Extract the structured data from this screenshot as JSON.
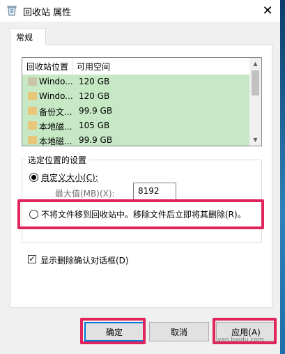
{
  "window": {
    "title": "回收站 属性",
    "close_label": "✕",
    "icon": "recycle-bin-icon"
  },
  "tabs": [
    {
      "label": "常规",
      "selected": true
    }
  ],
  "location_list": {
    "headers": {
      "location": "回收站位置",
      "space": "可用空间"
    },
    "rows": [
      {
        "name": "Windo...",
        "space": "120 GB",
        "icon": "drive-icon"
      },
      {
        "name": "Windo...",
        "space": "120 GB",
        "icon": "folder-icon"
      },
      {
        "name": "备份文...",
        "space": "99.9 GB",
        "icon": "folder-icon"
      },
      {
        "name": "本地磁...",
        "space": "105 GB",
        "icon": "folder-icon"
      },
      {
        "name": "本地磁...",
        "space": "99.9 GB",
        "icon": "folder-icon"
      }
    ]
  },
  "settings": {
    "group_title": "选定位置的设置",
    "custom_size_label": "自定义大小(C):",
    "max_label": "最大值(MB)(X):",
    "max_value": "8192",
    "no_move_label": "不将文件移到回收站中。移除文件后立即将其删除(R)。"
  },
  "confirm_delete_label": "显示删除确认对话框(D)",
  "buttons": {
    "ok": "确定",
    "cancel": "取消",
    "apply": "应用(A)"
  },
  "watermark": "yan.baidu.com",
  "colors": {
    "highlight": "#e0245c",
    "list_row_bg": "#c6e8c4",
    "accent": "#0078d7"
  }
}
